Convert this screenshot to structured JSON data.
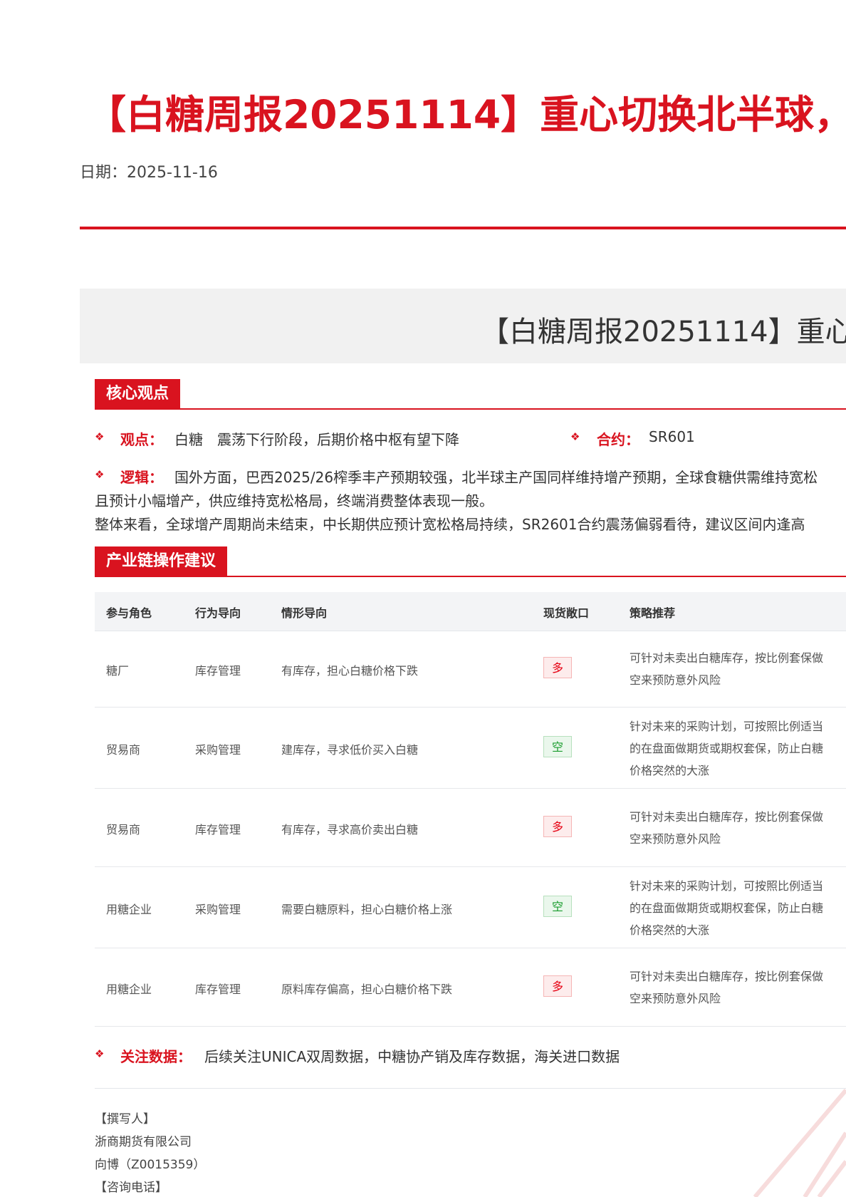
{
  "header": {
    "title": "【白糖周报20251114】重心切换北半球，",
    "date": "日期：2025-11-16",
    "banner_title": "【白糖周报20251114】重心"
  },
  "core": {
    "section_title": "核心观点",
    "view_label": "观点：",
    "view_text": "白糖　震荡下行阶段，后期价格中枢有望下降",
    "contract_label": "合约：",
    "contract_value": "SR601",
    "logic_label": "逻辑：",
    "logic_lines": [
      "国外方面，巴西2025/26榨季丰产预期较强，北半球主产国同样维持增产预期，全球食糖供需维持宽松",
      "且预计小幅增产，供应维持宽松格局，终端消费整体表现一般。",
      "整体来看，全球增产周期尚未结束，中长期供应预计宽松格局持续，SR2601合约震荡偏弱看待，建议区间内逢高"
    ]
  },
  "chain": {
    "section_title": "产业链操作建议",
    "columns": [
      "参与角色",
      "行为导向",
      "情形导向",
      "现货敞口",
      "策略推荐"
    ],
    "rows": [
      {
        "role": "糖厂",
        "behavior": "库存管理",
        "situation": "有库存，担心白糖价格下跌",
        "exposure": "多",
        "strategy": [
          "可针对未卖出白糖库存，按比例套保做",
          "空来预防意外风险"
        ]
      },
      {
        "role": "贸易商",
        "behavior": "采购管理",
        "situation": "建库存，寻求低价买入白糖",
        "exposure": "空",
        "strategy": [
          "针对未来的采购计划，可按照比例适当",
          "的在盘面做期货或期权套保，防止白糖",
          "价格突然的大涨"
        ]
      },
      {
        "role": "贸易商",
        "behavior": "库存管理",
        "situation": "有库存，寻求高价卖出白糖",
        "exposure": "多",
        "strategy": [
          "可针对未卖出白糖库存，按比例套保做",
          "空来预防意外风险"
        ]
      },
      {
        "role": "用糖企业",
        "behavior": "采购管理",
        "situation": "需要白糖原料，担心白糖价格上涨",
        "exposure": "空",
        "strategy": [
          "针对未来的采购计划，可按照比例适当",
          "的在盘面做期货或期权套保，防止白糖",
          "价格突然的大涨"
        ]
      },
      {
        "role": "用糖企业",
        "behavior": "库存管理",
        "situation": "原料库存偏高，担心白糖价格下跌",
        "exposure": "多",
        "strategy": [
          "可针对未卖出白糖库存，按比例套保做",
          "空来预防意外风险"
        ]
      }
    ]
  },
  "watch": {
    "label": "关注数据：",
    "text": "后续关注UNICA双周数据，中糖协产销及库存数据，海关进口数据"
  },
  "writer": {
    "lines": [
      "【撰写人】",
      "浙商期货有限公司",
      "向博（Z0015359）",
      "【咨询电话】"
    ]
  },
  "colors": {
    "accent": "#d9131f",
    "long": "#e60012",
    "short": "#1a9c2e",
    "banner_bg": "#f1f1f1"
  },
  "icons": {
    "bullet": "red-diamond-clover-icon"
  }
}
